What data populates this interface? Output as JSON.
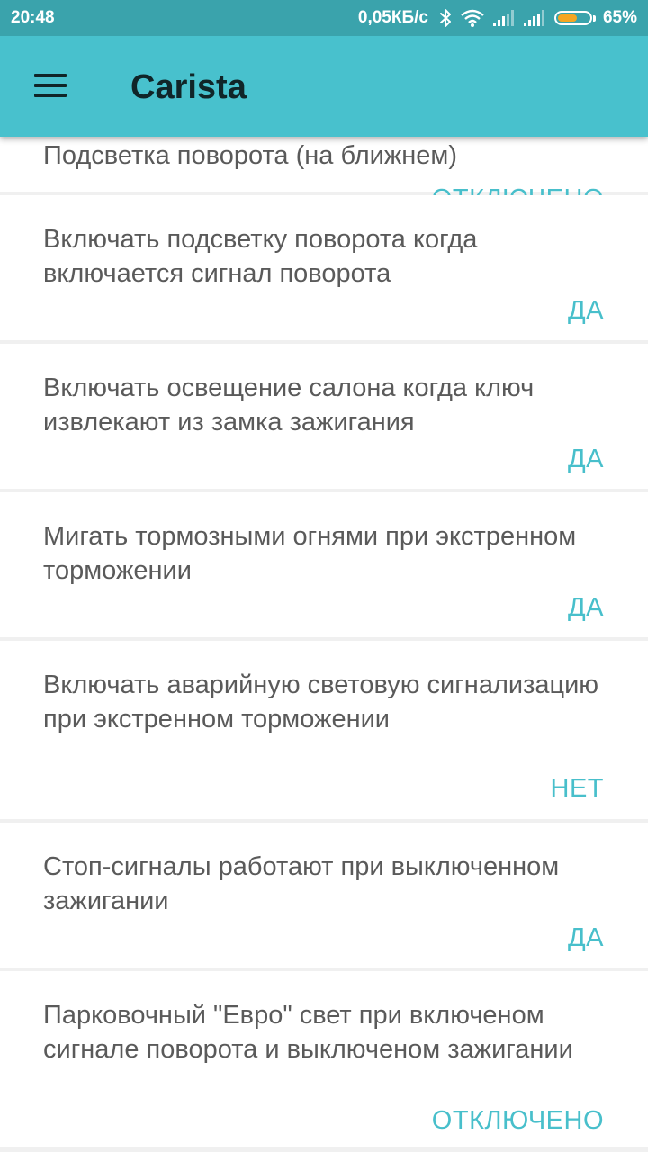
{
  "status_bar": {
    "time": "20:48",
    "network_speed": "0,05КБ/с",
    "battery_percent": "65%",
    "battery_level": 0.65,
    "icons": [
      "bluetooth-icon",
      "wifi-icon",
      "signal-icon",
      "signal-icon",
      "battery-icon"
    ]
  },
  "app_bar": {
    "title": "Carista",
    "menu_icon": "hamburger-menu-icon"
  },
  "colors": {
    "status_bar": "#3aa3ac",
    "app_bar": "#48c1cd",
    "accent": "#48bfcb",
    "label_text": "#5a5a5a",
    "card_background": "#ffffff",
    "divider": "#f0f0f0"
  },
  "settings": [
    {
      "label": "Подсветка поворота (на ближнем)",
      "value": "ОТКЛЮЧЕНО"
    },
    {
      "label": "Включать подсветку поворота когда включается сигнал поворота",
      "value": "ДА"
    },
    {
      "label": "Включать освещение салона когда ключ извлекают из замка зажигания",
      "value": "ДА"
    },
    {
      "label": "Мигать тормозными огнями при экстренном торможении",
      "value": "ДА"
    },
    {
      "label": "Включать аварийную световую сигнализацию при экстренном торможении",
      "value": "НЕТ"
    },
    {
      "label": "Стоп-сигналы работают при выключенном зажигании",
      "value": "ДА"
    },
    {
      "label": "Парковочный \"Евро\" свет при включеном сигнале поворота и выключеном зажигании",
      "value": "ОТКЛЮЧЕНО"
    }
  ]
}
